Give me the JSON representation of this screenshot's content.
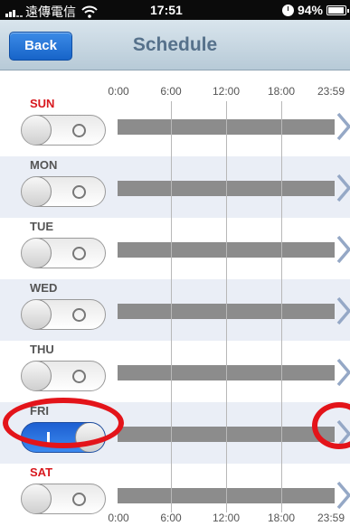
{
  "status_bar": {
    "carrier": "遠傳電信",
    "time": "17:51",
    "battery": "94%"
  },
  "nav": {
    "back_label": "Back",
    "title": "Schedule"
  },
  "axis": {
    "ticks": [
      "0:00",
      "6:00",
      "12:00",
      "18:00",
      "23:59"
    ]
  },
  "days": [
    {
      "label": "SUN",
      "enabled": false
    },
    {
      "label": "MON",
      "enabled": false
    },
    {
      "label": "TUE",
      "enabled": false
    },
    {
      "label": "WED",
      "enabled": false
    },
    {
      "label": "THU",
      "enabled": false
    },
    {
      "label": "FRI",
      "enabled": true
    },
    {
      "label": "SAT",
      "enabled": false
    }
  ],
  "colors": {
    "weekend_label": "#d8181e",
    "highlight": "#e3141a",
    "toggle_on": "#1d5fd1"
  }
}
